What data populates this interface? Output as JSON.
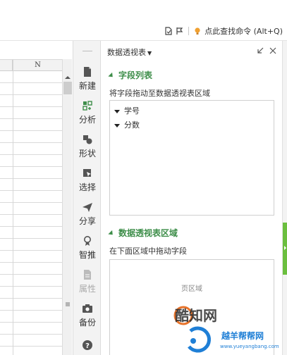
{
  "toolbar": {
    "command_search_label": "点此查找命令 (Alt+Q)"
  },
  "sheet": {
    "column_header": "N"
  },
  "tools": {
    "items": [
      {
        "label": "新建"
      },
      {
        "label": "分析"
      },
      {
        "label": "形状"
      },
      {
        "label": "选择"
      },
      {
        "label": "分享"
      },
      {
        "label": "智推"
      },
      {
        "label": "属性"
      },
      {
        "label": "备份"
      }
    ]
  },
  "panel": {
    "title": "数据透视表",
    "fields_section": {
      "heading": "字段列表",
      "hint": "将字段拖动至数据透视表区域",
      "fields": [
        "学号",
        "分数"
      ]
    },
    "area_section": {
      "heading": "数据透视表区域",
      "hint": "在下面区域中拖动字段",
      "page_area_label": "页区域"
    }
  },
  "watermark": {
    "line1": "酷知网",
    "line2": "越羊帮帮网",
    "line3": "www.yueyangbang.com"
  },
  "colors": {
    "accent_green": "#3e8e4a",
    "edge_tab_green": "#6bbf3e",
    "watermark_blue": "#1f7fd6"
  }
}
